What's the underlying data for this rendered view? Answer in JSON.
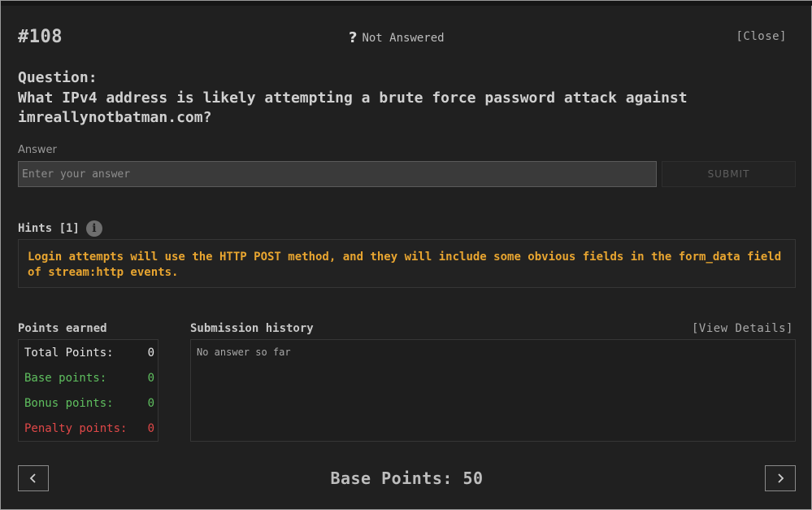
{
  "header": {
    "question_number": "#108",
    "status_icon": "question-mark-icon",
    "status_text": "Not Answered",
    "close_label": "[Close]"
  },
  "question": {
    "label": "Question:",
    "text": "What IPv4 address is likely attempting a brute force password attack against imreallynotbatman.com?"
  },
  "answer": {
    "label": "Answer",
    "placeholder": "Enter your answer",
    "value": "",
    "submit_label": "SUBMIT"
  },
  "hints": {
    "label": "Hints [1]",
    "icon": "info-icon",
    "text": "Login attempts will use the HTTP POST method, and they will include some obvious fields in the form_data field of stream:http events."
  },
  "points": {
    "label": "Points earned",
    "total_label": "Total Points:",
    "total_value": "0",
    "base_label": "Base points:",
    "base_value": "0",
    "bonus_label": "Bonus points:",
    "bonus_value": "0",
    "penalty_label": "Penalty points:",
    "penalty_value": "0"
  },
  "history": {
    "label": "Submission history",
    "view_details_label": "[View Details]",
    "empty_text": "No answer so far"
  },
  "footer": {
    "prev_icon": "chevron-left-icon",
    "next_icon": "chevron-right-icon",
    "base_points_text": "Base Points: 50"
  },
  "colors": {
    "background": "#202020",
    "hint_text": "#e8a530",
    "positive": "#5fbf5f",
    "penalty": "#e04848"
  }
}
